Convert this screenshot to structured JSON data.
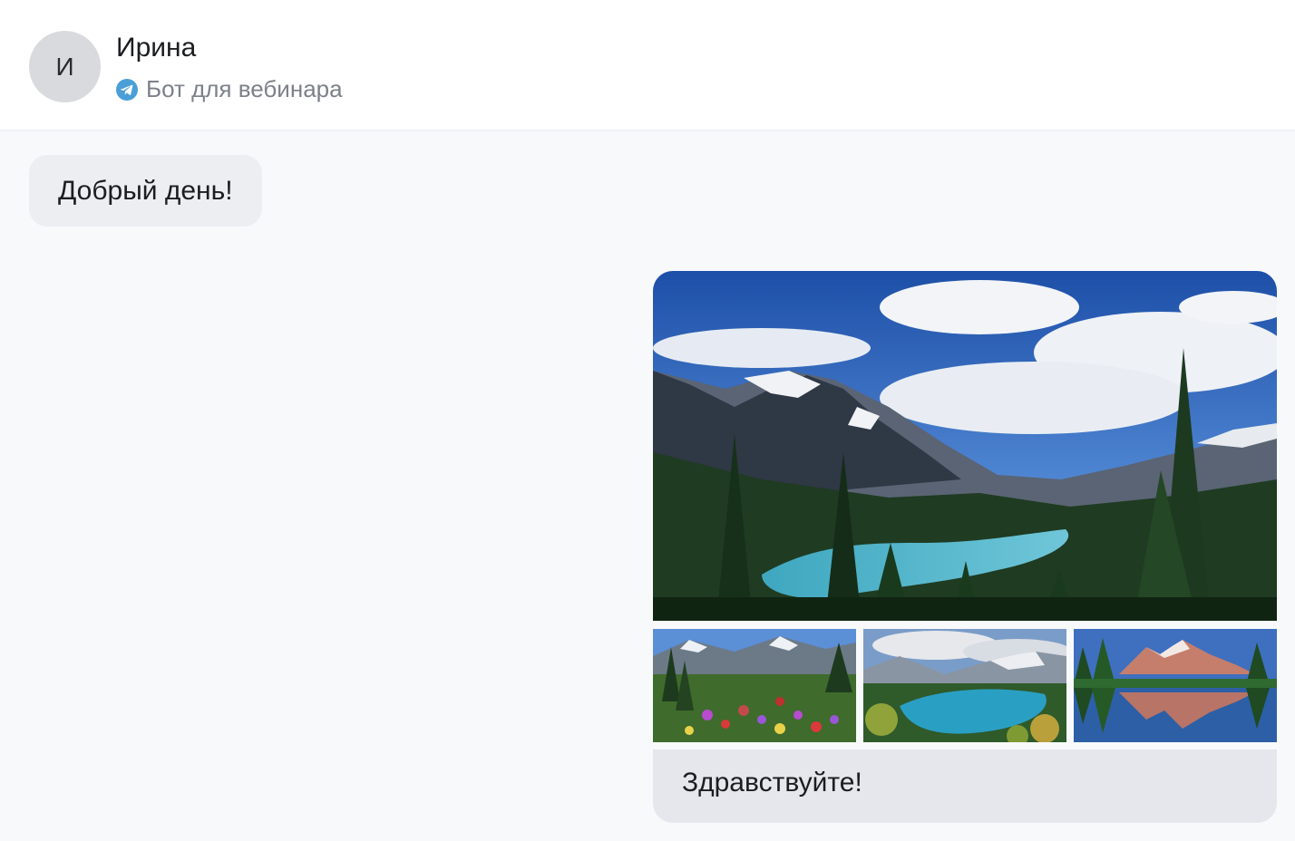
{
  "header": {
    "avatar_initial": "И",
    "contact_name": "Ирина",
    "channel_label": "Бот для вебинара",
    "channel_icon": "telegram-icon",
    "channel_icon_color": "#4a9fd8"
  },
  "messages": [
    {
      "direction": "incoming",
      "text": "Добрый день!"
    },
    {
      "direction": "outgoing",
      "photos": [
        "mountain-lake-photo",
        "wildflower-meadow-photo",
        "blue-lake-photo",
        "reflection-lake-photo"
      ],
      "text": "Здравствуйте!"
    }
  ],
  "colors": {
    "background": "#f8f9fb",
    "header_background": "#ffffff",
    "incoming_bubble": "#edeef2",
    "outgoing_bubble": "#e6e7ec",
    "avatar_background": "#d8dade"
  }
}
